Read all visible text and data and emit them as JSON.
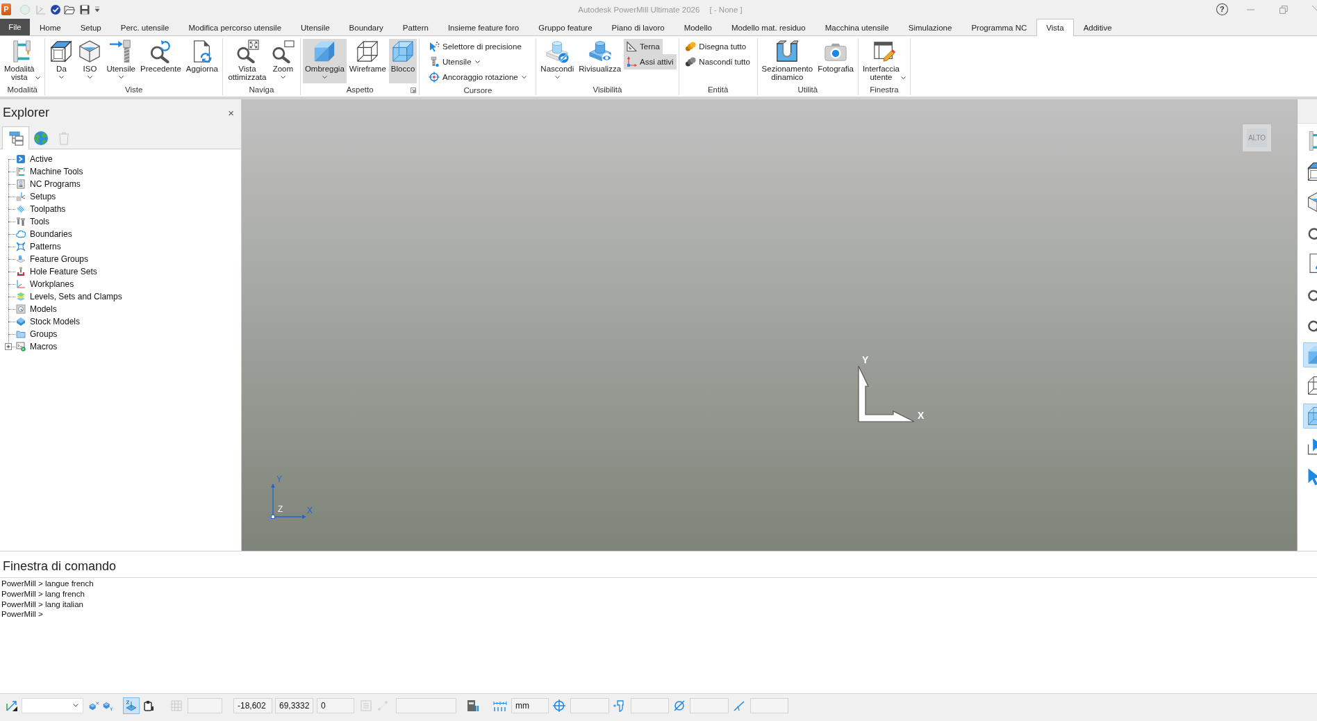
{
  "title_bar": {
    "app_logo": "P",
    "quick_access": [
      {
        "disabled": true
      },
      {
        "disabled": true
      },
      {
        "disabled": false
      },
      {
        "disabled": false
      },
      {
        "disabled": false
      },
      {
        "disabled": false
      }
    ],
    "title": "Autodesk PowerMill Ultimate 2026",
    "document": "[ - None ]",
    "help": "?"
  },
  "ribbon": {
    "file": "File",
    "tabs": [
      {
        "label": "Home",
        "selected": false
      },
      {
        "label": "Setup",
        "selected": false
      },
      {
        "label": "Perc. utensile",
        "selected": false
      },
      {
        "label": "Modifica percorso utensile",
        "selected": false
      },
      {
        "label": "Utensile",
        "selected": false
      },
      {
        "label": "Boundary",
        "selected": false
      },
      {
        "label": "Pattern",
        "selected": false
      },
      {
        "label": "Insieme feature foro",
        "selected": false
      },
      {
        "label": "Gruppo feature",
        "selected": false
      },
      {
        "label": "Piano di lavoro",
        "selected": false
      },
      {
        "label": "Modello",
        "selected": false
      },
      {
        "label": "Modello mat. residuo",
        "selected": false
      },
      {
        "label": "Macchina utensile",
        "selected": false
      },
      {
        "label": "Simulazione",
        "selected": false
      },
      {
        "label": "Programma NC",
        "selected": false
      },
      {
        "label": "Vista",
        "selected": true
      },
      {
        "label": "Additive",
        "selected": false
      }
    ],
    "groups": [
      {
        "label": "Modalità",
        "launcher": false,
        "buttons": [
          {
            "label": "Modalità vista",
            "kind": "large",
            "dropdown": true,
            "on": false
          }
        ]
      },
      {
        "label": "Viste",
        "launcher": false,
        "buttons": [
          {
            "label": "Da",
            "kind": "large",
            "dropdown": true,
            "on": false
          },
          {
            "label": "ISO",
            "kind": "large",
            "dropdown": true,
            "on": false
          },
          {
            "label": "Utensile",
            "kind": "large",
            "dropdown": true,
            "on": false
          },
          {
            "label": "Precedente",
            "kind": "large",
            "dropdown": false,
            "on": false
          },
          {
            "label": "Aggiorna",
            "kind": "large",
            "dropdown": false,
            "on": false
          }
        ]
      },
      {
        "label": "Naviga",
        "launcher": false,
        "buttons": [
          {
            "label": "Vista ottimizzata",
            "kind": "large",
            "dropdown": false,
            "on": false
          },
          {
            "label": "Zoom",
            "kind": "large",
            "dropdown": true,
            "on": false
          }
        ]
      },
      {
        "label": "Aspetto",
        "launcher": true,
        "buttons": [
          {
            "label": "Ombreggia",
            "kind": "large",
            "dropdown": true,
            "on": true
          },
          {
            "label": "Wireframe",
            "kind": "large",
            "dropdown": false,
            "on": false
          },
          {
            "label": "Blocco",
            "kind": "large",
            "dropdown": false,
            "on": true
          }
        ]
      },
      {
        "label": "Cursore",
        "launcher": false,
        "buttons": [
          {
            "label": "Selettore di precisione",
            "kind": "small",
            "dropdown": false,
            "on": false
          },
          {
            "label": "Utensile",
            "kind": "small",
            "dropdown": true,
            "on": false
          },
          {
            "label": "Ancoraggio rotazione",
            "kind": "small",
            "dropdown": true,
            "on": false
          }
        ]
      },
      {
        "label": "Visibilità",
        "launcher": false,
        "buttons": [
          {
            "label": "Nascondi",
            "kind": "large",
            "dropdown": true,
            "on": false
          },
          {
            "label": "Rivisualizza",
            "kind": "large",
            "dropdown": false,
            "on": false
          },
          {
            "label": "Terna",
            "kind": "small",
            "dropdown": false,
            "on": true
          },
          {
            "label": "Assi attivi",
            "kind": "small",
            "dropdown": false,
            "on": true
          }
        ]
      },
      {
        "label": "Entità",
        "launcher": false,
        "buttons": [
          {
            "label": "Disegna tutto",
            "kind": "small",
            "dropdown": false,
            "on": false
          },
          {
            "label": "Nascondi tutto",
            "kind": "small",
            "dropdown": false,
            "on": false
          }
        ]
      },
      {
        "label": "Utilità",
        "launcher": false,
        "buttons": [
          {
            "label": "Sezionamento dinamico",
            "kind": "large",
            "dropdown": false,
            "on": false
          },
          {
            "label": "Fotografia",
            "kind": "large",
            "dropdown": false,
            "on": false
          }
        ]
      },
      {
        "label": "Finestra",
        "launcher": false,
        "buttons": [
          {
            "label": "Interfaccia utente",
            "kind": "large",
            "dropdown": true,
            "on": false
          }
        ]
      }
    ]
  },
  "explorer": {
    "title": "Explorer",
    "close": "×",
    "tabs": [
      {
        "selected": true,
        "disabled": false
      },
      {
        "selected": false,
        "disabled": false
      },
      {
        "selected": false,
        "disabled": true
      }
    ],
    "items": [
      {
        "label": "Active"
      },
      {
        "label": "Machine Tools"
      },
      {
        "label": "NC Programs"
      },
      {
        "label": "Setups"
      },
      {
        "label": "Toolpaths"
      },
      {
        "label": "Tools"
      },
      {
        "label": "Boundaries"
      },
      {
        "label": "Patterns"
      },
      {
        "label": "Feature Groups"
      },
      {
        "label": "Hole Feature Sets"
      },
      {
        "label": "Workplanes"
      },
      {
        "label": "Levels, Sets and Clamps"
      },
      {
        "label": "Models"
      },
      {
        "label": "Stock Models"
      },
      {
        "label": "Groups"
      },
      {
        "label": "Macros",
        "expanded": false
      }
    ]
  },
  "viewport": {
    "view_label": "ALTO",
    "triad": {
      "y": "Y",
      "x": "X"
    },
    "mini_triad": {
      "y": "Y",
      "z": "Z",
      "x": "X"
    }
  },
  "side_toolbar": [
    {
      "selected": false
    },
    {
      "selected": false
    },
    {
      "selected": false
    },
    {
      "selected": false
    },
    {
      "selected": false
    },
    {
      "selected": false
    },
    {
      "selected": false
    },
    {
      "selected": true
    },
    {
      "selected": false
    },
    {
      "selected": true
    },
    {
      "selected": false
    },
    {
      "selected": false
    }
  ],
  "command_window": {
    "title": "Finestra di comando",
    "lines": [
      "PowerMill > langue french",
      "PowerMill > lang french",
      "PowerMill > lang italian",
      "PowerMill >"
    ]
  },
  "status_bar": {
    "items": [
      {
        "kind": "icon",
        "selected": false,
        "disabled": false
      },
      {
        "kind": "dropdown"
      },
      {
        "kind": "icon",
        "selected": false,
        "disabled": false
      },
      {
        "kind": "icon",
        "selected": false,
        "disabled": false
      },
      {
        "kind": "icon",
        "selected": true,
        "disabled": false
      },
      {
        "kind": "icon",
        "selected": false,
        "disabled": false
      },
      {
        "kind": "icon",
        "selected": false,
        "disabled": true
      },
      {
        "kind": "field"
      },
      {
        "kind": "field",
        "value": "-18,602"
      },
      {
        "kind": "field",
        "value": "69,3332"
      },
      {
        "kind": "field",
        "value": "0"
      },
      {
        "kind": "icon",
        "selected": false,
        "disabled": true
      },
      {
        "kind": "icon",
        "selected": false,
        "disabled": true
      },
      {
        "kind": "field"
      },
      {
        "kind": "icon",
        "selected": false,
        "disabled": false
      },
      {
        "kind": "icon",
        "selected": false,
        "disabled": false
      },
      {
        "kind": "field",
        "value": "mm"
      },
      {
        "kind": "icon",
        "selected": false,
        "disabled": false
      },
      {
        "kind": "field"
      },
      {
        "kind": "icon",
        "selected": false,
        "disabled": false
      },
      {
        "kind": "field"
      },
      {
        "kind": "icon",
        "selected": false,
        "disabled": false
      },
      {
        "kind": "field"
      },
      {
        "kind": "icon",
        "selected": false,
        "disabled": false
      },
      {
        "kind": "field"
      }
    ]
  }
}
